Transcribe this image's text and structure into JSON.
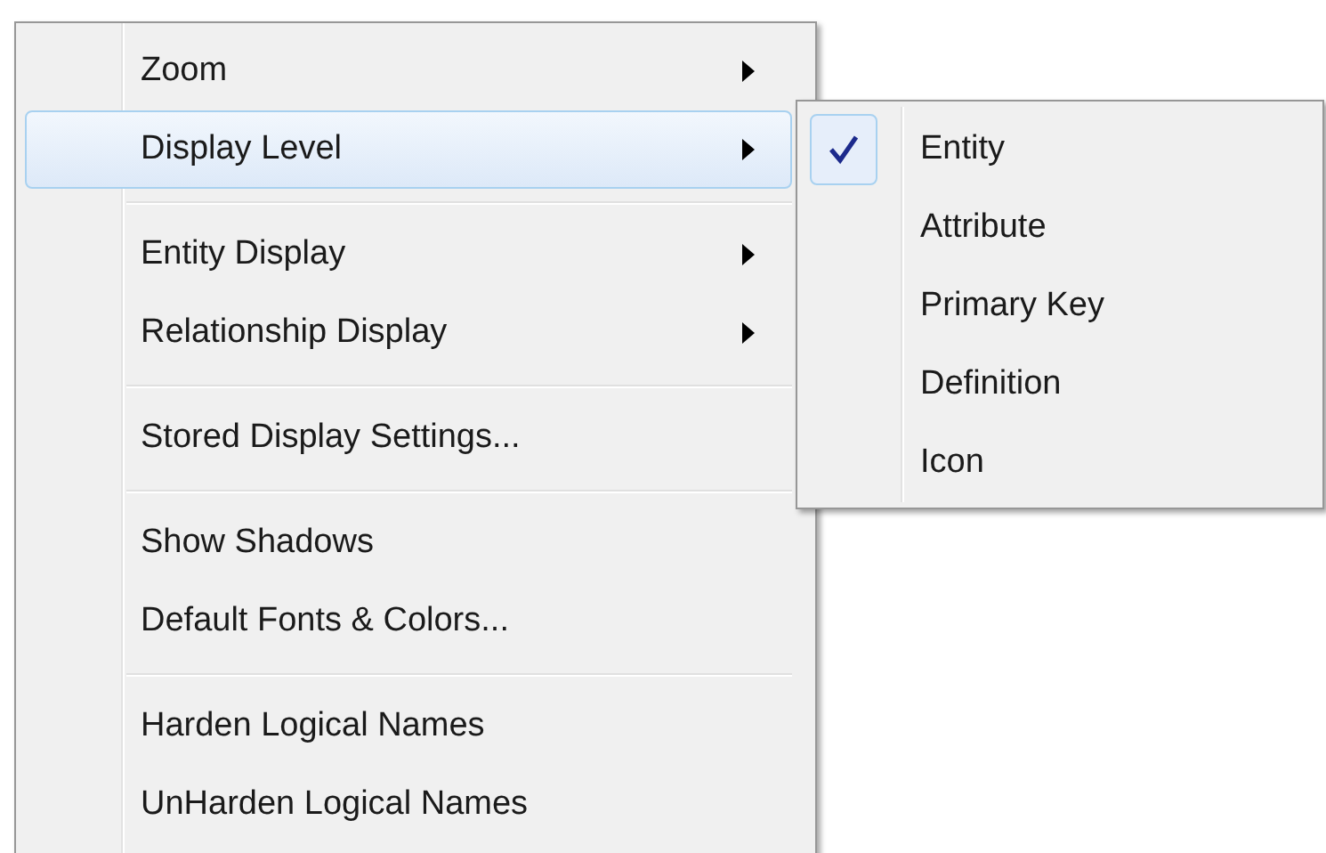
{
  "menu": {
    "items": [
      {
        "kind": "item",
        "label": "Zoom",
        "has_submenu": true,
        "selected": false
      },
      {
        "kind": "item",
        "label": "Display Level",
        "has_submenu": true,
        "selected": true
      },
      {
        "kind": "separator"
      },
      {
        "kind": "item",
        "label": "Entity Display",
        "has_submenu": true,
        "selected": false
      },
      {
        "kind": "item",
        "label": "Relationship Display",
        "has_submenu": true,
        "selected": false
      },
      {
        "kind": "separator"
      },
      {
        "kind": "item",
        "label": "Stored Display Settings...",
        "has_submenu": false,
        "selected": false
      },
      {
        "kind": "separator"
      },
      {
        "kind": "item",
        "label": "Show Shadows",
        "has_submenu": false,
        "selected": false
      },
      {
        "kind": "item",
        "label": "Default Fonts & Colors...",
        "has_submenu": false,
        "selected": false
      },
      {
        "kind": "separator"
      },
      {
        "kind": "item",
        "label": "Harden Logical Names",
        "has_submenu": false,
        "selected": false
      },
      {
        "kind": "item",
        "label": "UnHarden Logical Names",
        "has_submenu": false,
        "selected": false
      }
    ]
  },
  "submenu": {
    "items": [
      {
        "label": "Entity",
        "checked": true
      },
      {
        "label": "Attribute",
        "checked": false
      },
      {
        "label": "Primary Key",
        "checked": false
      },
      {
        "label": "Definition",
        "checked": false
      },
      {
        "label": "Icon",
        "checked": false
      }
    ]
  }
}
